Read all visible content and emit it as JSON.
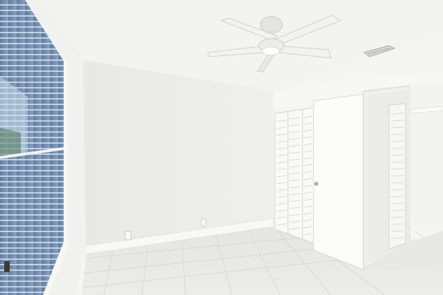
{
  "scene": {
    "kind": "photo",
    "subject": "empty-bedroom",
    "features": [
      "window-blinds",
      "ceiling-fan-with-light",
      "bifold-louvered-closet-door",
      "open-closet-door",
      "walk-in-closet",
      "hvac-vent",
      "tile-floor",
      "baseboard",
      "wall-outlet"
    ]
  },
  "colors": {
    "wall_back": "#eeeeeb",
    "wall_left": "#f2f2ef",
    "ceiling": "#f4f4f1",
    "floor": "#e6e6e2",
    "blinds": "#6a84a6",
    "door": "#fbfbfa"
  }
}
